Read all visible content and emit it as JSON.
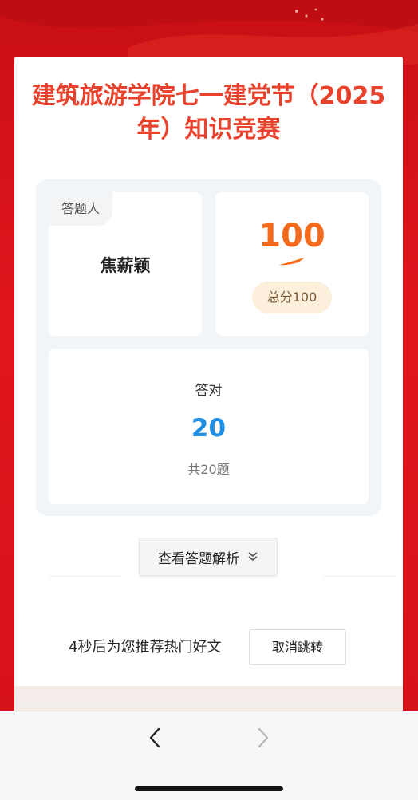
{
  "title": "建筑旅游学院七一建党节（2025年）知识竞赛",
  "respondent": {
    "tag": "答题人",
    "name": "焦薪颖"
  },
  "score": {
    "value": "100",
    "total_label": "总分100"
  },
  "correct": {
    "label": "答对",
    "count": "20",
    "total_label": "共20题"
  },
  "analysis_button": {
    "label": "查看答题解析",
    "icon": "double-chevron-down-icon"
  },
  "redirect": {
    "text": "4秒后为您推荐热门好文",
    "cancel_label": "取消跳转"
  },
  "colors": {
    "background": "#d8141a",
    "title": "#e8412c",
    "score": "#f36a1c",
    "correct": "#1f8fe6"
  },
  "browser_nav": {
    "back_icon": "chevron-left-icon",
    "forward_icon": "chevron-right-icon"
  }
}
